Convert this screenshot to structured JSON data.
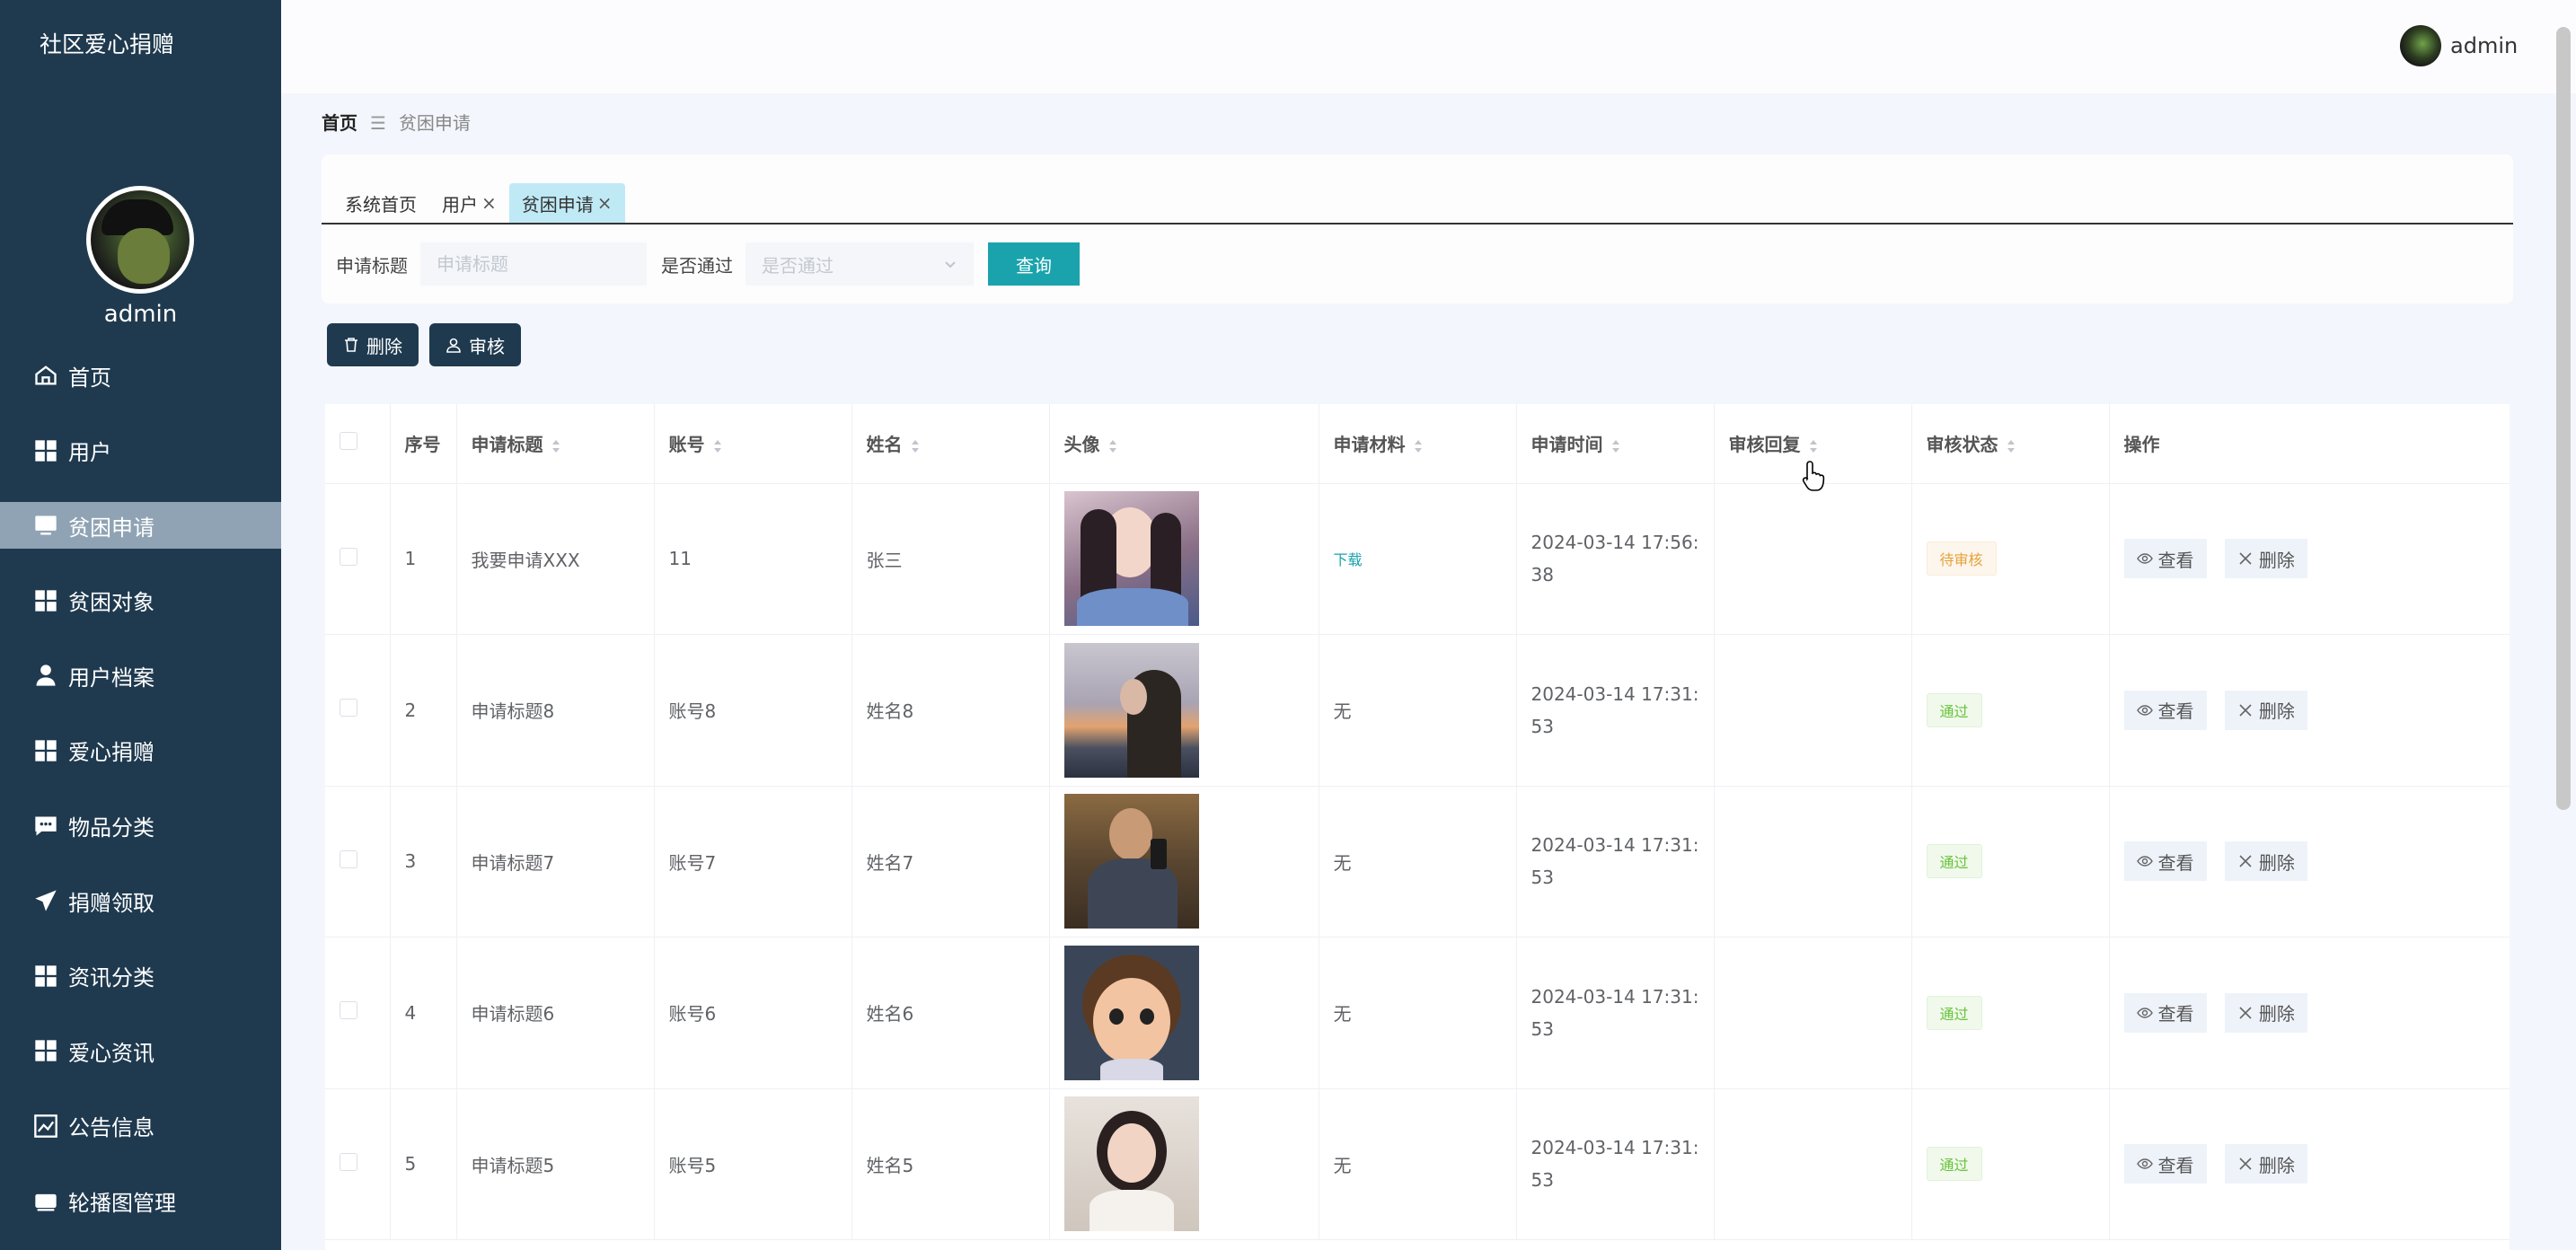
{
  "app": {
    "title": "社区爱心捐赠"
  },
  "sidebar": {
    "username": "admin",
    "items": [
      {
        "label": "首页",
        "icon": "home-icon",
        "active": false
      },
      {
        "label": "用户",
        "icon": "grid-icon",
        "active": false
      },
      {
        "label": "贫困申请",
        "icon": "monitor-icon",
        "active": true
      },
      {
        "label": "贫困对象",
        "icon": "grid-icon",
        "active": false
      },
      {
        "label": "用户档案",
        "icon": "user-icon",
        "active": false
      },
      {
        "label": "爱心捐赠",
        "icon": "grid-icon",
        "active": false
      },
      {
        "label": "物品分类",
        "icon": "chat-icon",
        "active": false
      },
      {
        "label": "捐赠领取",
        "icon": "send-icon",
        "active": false
      },
      {
        "label": "资讯分类",
        "icon": "grid-icon",
        "active": false
      },
      {
        "label": "爱心资讯",
        "icon": "grid-icon",
        "active": false
      },
      {
        "label": "公告信息",
        "icon": "chart-icon",
        "active": false
      },
      {
        "label": "轮播图管理",
        "icon": "carousel-icon",
        "active": false
      }
    ]
  },
  "topbar": {
    "username": "admin"
  },
  "breadcrumb": {
    "home": "首页",
    "separator": "☰",
    "current": "贫困申请"
  },
  "tabs": [
    {
      "label": "系统首页",
      "closable": false,
      "active": false
    },
    {
      "label": "用户",
      "closable": true,
      "active": false
    },
    {
      "label": "贫困申请",
      "closable": true,
      "active": true
    }
  ],
  "search": {
    "title_label": "申请标题",
    "title_placeholder": "申请标题",
    "pass_label": "是否通过",
    "pass_placeholder": "是否通过",
    "query_button": "查询"
  },
  "actions": {
    "delete": "删除",
    "review": "审核"
  },
  "table": {
    "columns": [
      "序号",
      "申请标题",
      "账号",
      "姓名",
      "头像",
      "申请材料",
      "申请时间",
      "审核回复",
      "审核状态",
      "操作"
    ],
    "rows": [
      {
        "index": "1",
        "title": "我要申请XXX",
        "account": "11",
        "name": "张三",
        "material": "下载",
        "time_a": "2024-03-14 17:56:",
        "time_b": "38",
        "reply": "",
        "status": "待审核",
        "status_type": "pending",
        "photo": "girl-long-hair"
      },
      {
        "index": "2",
        "title": "申请标题8",
        "account": "账号8",
        "name": "姓名8",
        "material": "无",
        "time_a": "2024-03-14 17:31:",
        "time_b": "53",
        "reply": "",
        "status": "通过",
        "status_type": "pass",
        "photo": "girl-sunset"
      },
      {
        "index": "3",
        "title": "申请标题7",
        "account": "账号7",
        "name": "姓名7",
        "material": "无",
        "time_a": "2024-03-14 17:31:",
        "time_b": "53",
        "reply": "",
        "status": "通过",
        "status_type": "pass",
        "photo": "man-selfie"
      },
      {
        "index": "4",
        "title": "申请标题6",
        "account": "账号6",
        "name": "姓名6",
        "material": "无",
        "time_a": "2024-03-14 17:31:",
        "time_b": "53",
        "reply": "",
        "status": "通过",
        "status_type": "pass",
        "photo": "cartoon-boy"
      },
      {
        "index": "5",
        "title": "申请标题5",
        "account": "账号5",
        "name": "姓名5",
        "material": "无",
        "time_a": "2024-03-14 17:31:",
        "time_b": "53",
        "reply": "",
        "status": "通过",
        "status_type": "pass",
        "photo": "girl-bow"
      }
    ],
    "view_label": "查看",
    "delete_label": "删除"
  },
  "colors": {
    "sidebar_bg": "#1f3a4f",
    "sidebar_active": "#8fa3b4",
    "accent": "#1aa3ac",
    "tab_active": "#bfe9f5"
  }
}
